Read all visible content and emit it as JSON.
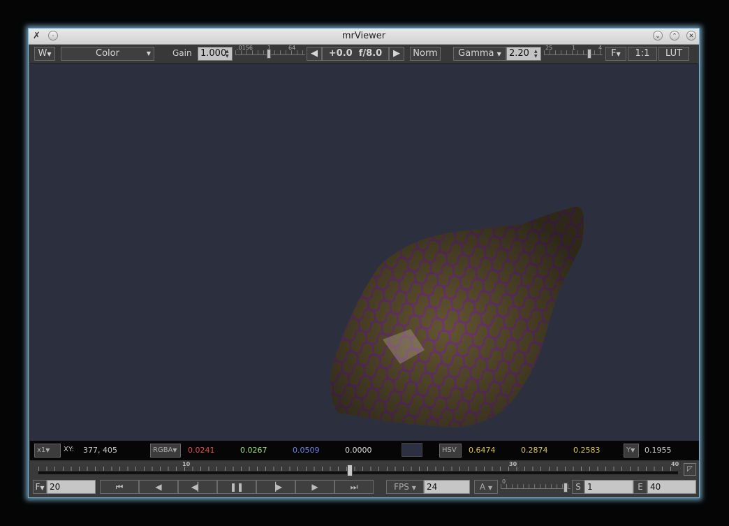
{
  "window": {
    "title": "mrViewer"
  },
  "toolbar": {
    "view_menu": "W",
    "channel": "Color",
    "gain_label": "Gain",
    "gain_value": "1.000",
    "gain_slider_labels": [
      ".0156",
      "1",
      "64"
    ],
    "exposure": "+0.0",
    "fstop": "f/8.0",
    "norm": "Norm",
    "gamma_label": "Gamma",
    "gamma_value": "2.20",
    "gamma_slider_labels": [
      "25",
      "1",
      "4"
    ],
    "gamma_slider_value": 0.8,
    "gain_slider_value": 0.48,
    "filter_menu": "F",
    "zoom": "1:1",
    "lut": "LUT"
  },
  "pixel_bar": {
    "zoom_menu": "x1",
    "xy_label": "XY:",
    "x": "377,",
    "y": "405",
    "rgba_menu": "RGBA",
    "r": "0.0241",
    "g": "0.0267",
    "b": "0.0509",
    "a": "0.0000",
    "hsv_menu": "HSV",
    "h": "0.6474",
    "s": "0.2874",
    "v": "0.2583",
    "lum_menu": "Y",
    "lum": "0.1955",
    "colors": {
      "r": "#e05050",
      "g": "#9fe07a",
      "b": "#6d86e6",
      "a": "#dddddd",
      "hsv": "#d8c35a",
      "swatch": "#2d2f42"
    }
  },
  "timeline": {
    "tick_labels": [
      "10",
      "30",
      "40"
    ],
    "current_frame": 20,
    "start": 1,
    "end": 40
  },
  "controls": {
    "frame_menu": "F",
    "frame_value": "20",
    "buttons": [
      "first-frame",
      "step-back",
      "play-back",
      "pause",
      "play-forward",
      "step-forward",
      "last-frame"
    ],
    "fps_menu": "FPS",
    "fps_value": "24",
    "audio_menu": "A",
    "audio_slider_label": "0",
    "start_label": "S",
    "start_value": "1",
    "end_label": "E",
    "end_value": "40"
  },
  "viewport": {
    "background": "#2c2f3e"
  }
}
